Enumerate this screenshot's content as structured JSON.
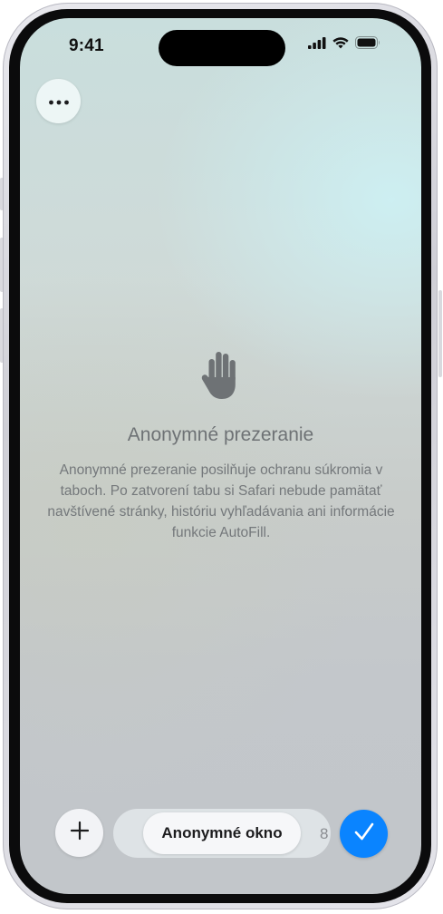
{
  "status_bar": {
    "time": "9:41",
    "icons": [
      "signal-icon",
      "wifi-icon",
      "battery-icon"
    ]
  },
  "top_bar": {
    "more_icon": "ellipsis-icon"
  },
  "private_browsing": {
    "icon": "hand-icon",
    "title": "Anonymné prezeranie",
    "description": "Anonymné prezeranie posilňuje ochranu súkromia v taboch. Po zatvorení tabu si Safari nebude pamätať navštívené stránky, históriu vyhľadávania ani informácie funkcie AutoFill."
  },
  "toolbar": {
    "add_icon": "plus-icon",
    "selected_tab_group": "Anonymné okno",
    "other_tab_group_partial": "8",
    "done_icon": "checkmark-icon",
    "accent_color": "#0a84ff"
  }
}
